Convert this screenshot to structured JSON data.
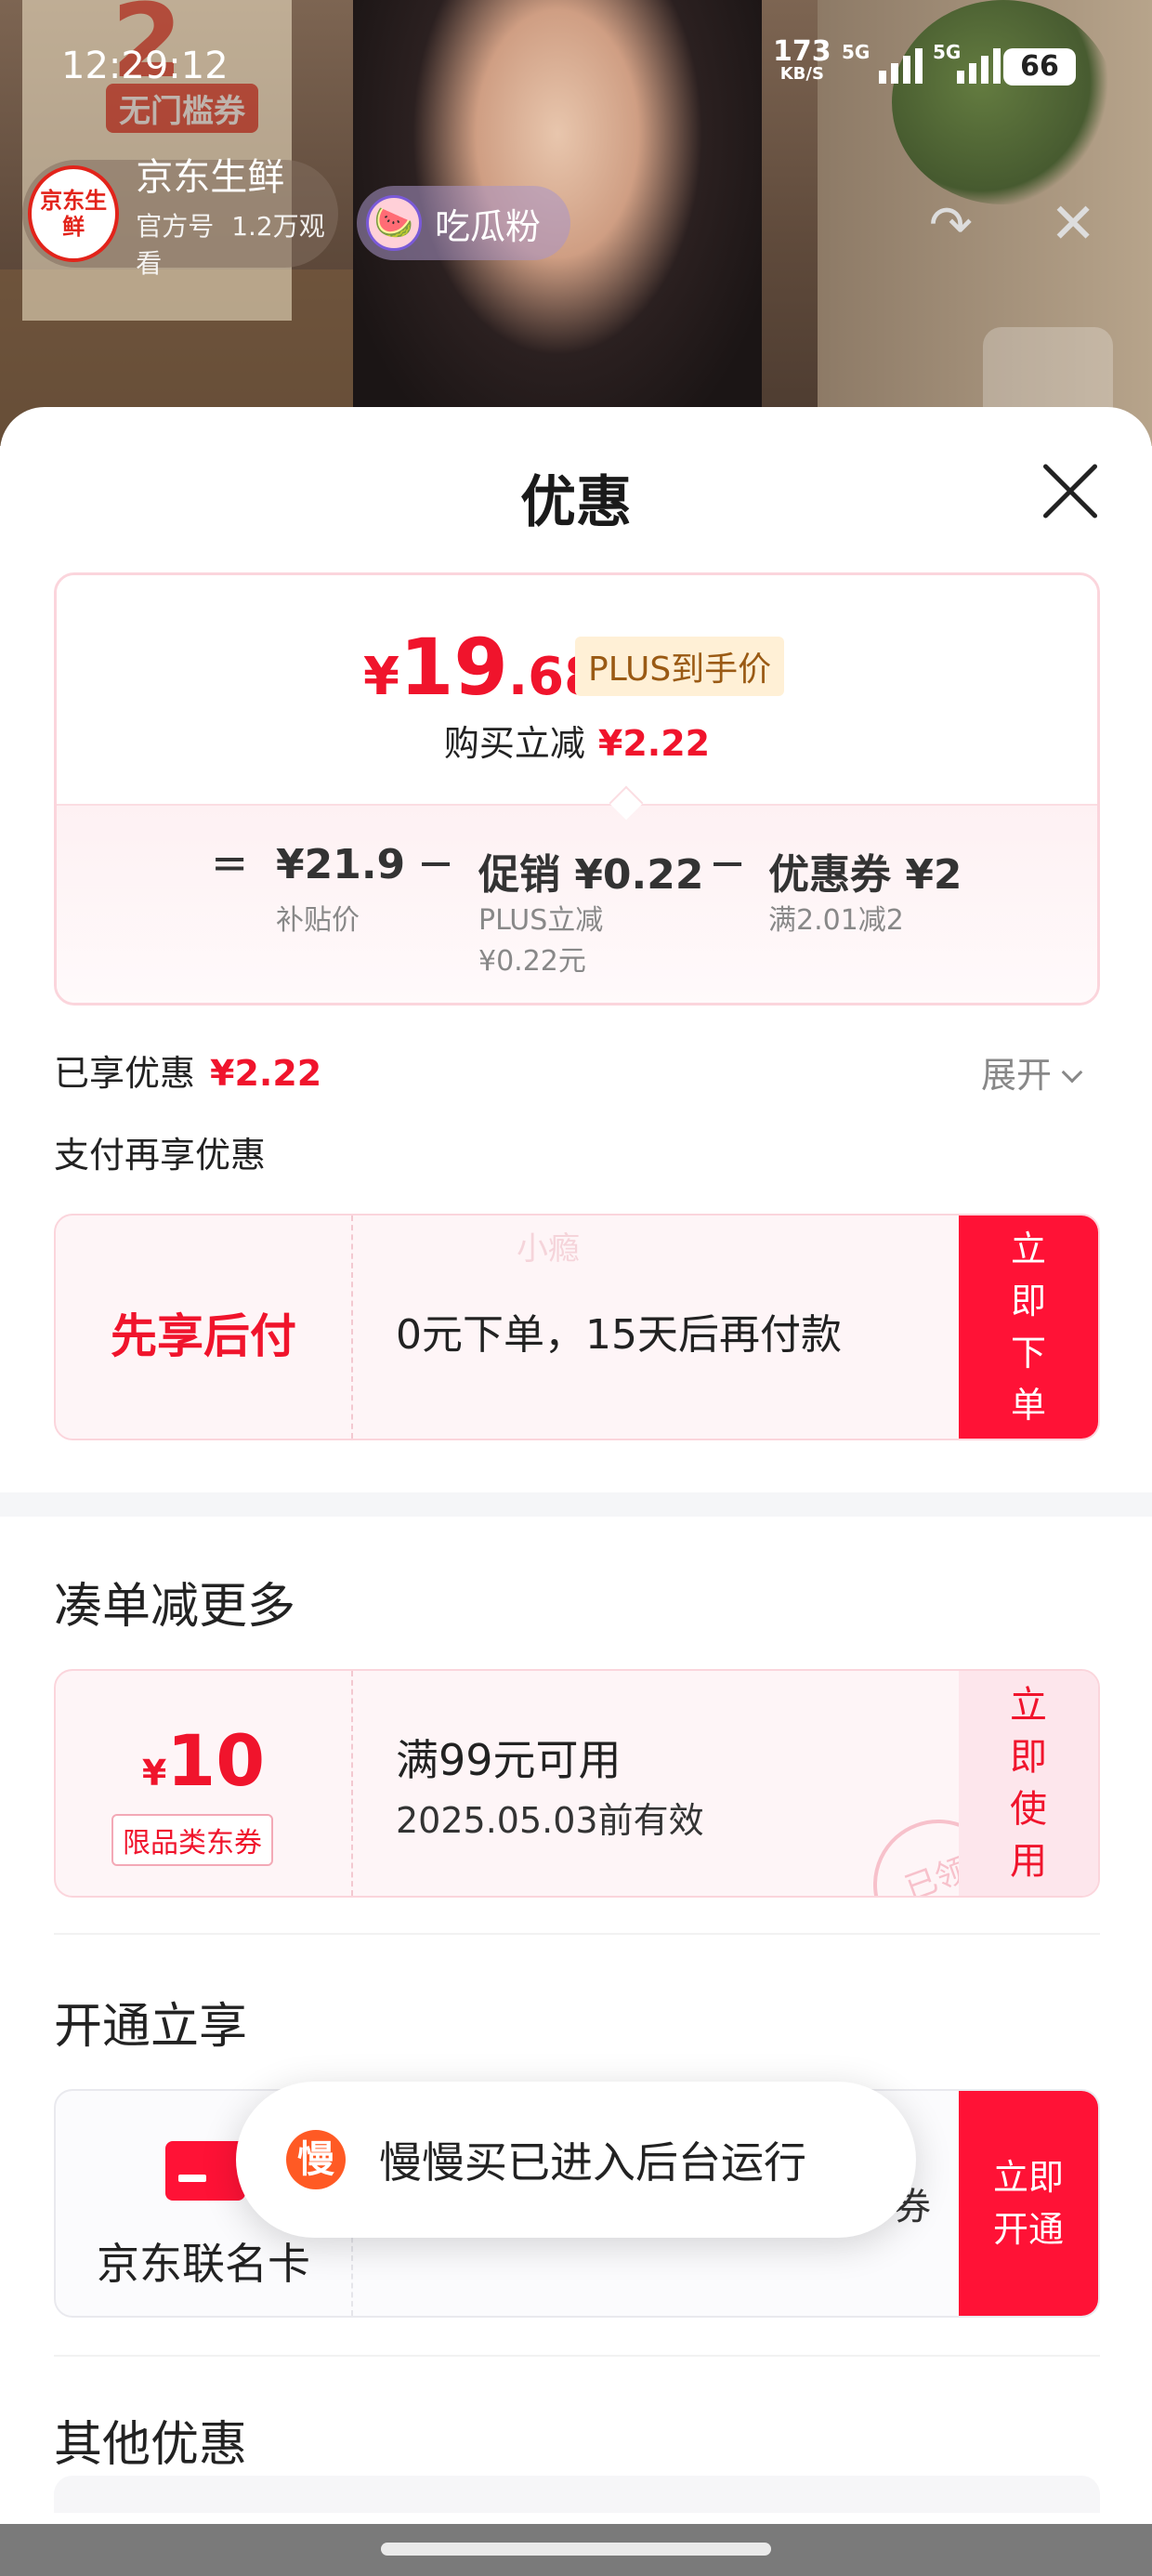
{
  "status_bar": {
    "time": "12:29:12",
    "net_speed": "173",
    "net_unit": "KB/S",
    "sim1": "5G",
    "sim2": "5G",
    "battery": "66"
  },
  "live": {
    "shop_logo": "京东生鲜",
    "shop_name": "京东生鲜",
    "official_tag": "官方号",
    "viewers": "1.2万观看",
    "fans_label": "吃瓜粉",
    "background_sign_big": "2",
    "background_sign_coupon": "无门槛券"
  },
  "sheet": {
    "title": "优惠",
    "price_card": {
      "currency": "¥",
      "final_int": "19",
      "final_dec": ".68",
      "plus_tag": "PLUS到手价",
      "reduce_label": "购买立减",
      "reduce_value": "¥2.22",
      "formula": {
        "eq": "=",
        "base_value": "¥21.9",
        "base_label": "补贴价",
        "minus1": "−",
        "promo_value": "促销 ¥0.22",
        "promo_line1": "PLUS立减",
        "promo_line2": "¥0.22元",
        "minus2": "−",
        "coupon_value": "优惠券 ¥2",
        "coupon_label": "满2.01减2"
      }
    },
    "enjoyed_label": "已享优惠",
    "enjoyed_value": "¥2.22",
    "expand_label": "展开",
    "pay_more_label": "支付再享优惠",
    "pay_later": {
      "title": "先享后付",
      "watermark": "小瘾",
      "desc": "0元下单，15天后再付款",
      "button": "立即下单"
    },
    "section_more": "凑单减更多",
    "coupon": {
      "currency": "¥",
      "amount": "10",
      "kind": "限品类东券",
      "condition": "满99元可用",
      "expiry": "2025.05.03前有效",
      "stamp": "已领",
      "button": "立即使用"
    },
    "section_open": "开通立享",
    "jd_card": {
      "label": "京东联名卡",
      "tail": "券",
      "button": "立即开通"
    },
    "section_other": "其他优惠"
  },
  "toast": {
    "icon_char": "慢",
    "text": "慢慢买已进入后台运行"
  },
  "colors": {
    "accent_red": "#f0142c",
    "button_red": "#ff1236",
    "plus_tag_bg": "#fff0d6"
  }
}
